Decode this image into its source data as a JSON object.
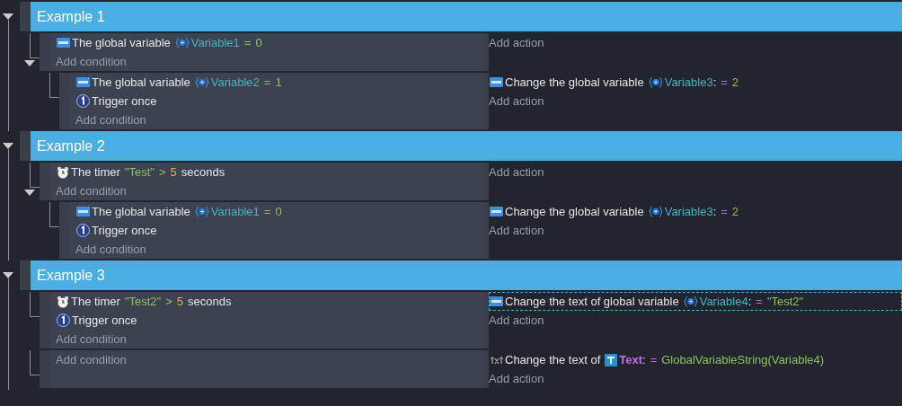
{
  "groups": [
    {
      "title": "Example 1",
      "expanded": true,
      "events": [
        {
          "expanded": true,
          "conditions": [
            {
              "kind": "variable",
              "selected": false,
              "parts": [
                {
                  "kind": "plain",
                  "text": "The global variable"
                },
                {
                  "kind": "variable",
                  "text": "Variable1"
                },
                {
                  "kind": "operator",
                  "text": "="
                },
                {
                  "kind": "number",
                  "text": "0"
                }
              ]
            }
          ],
          "add_condition": "Add condition",
          "add_action": "Add action",
          "children": [
            {
              "conditions": [
                {
                  "kind": "variable",
                  "selected": false,
                  "parts": [
                    {
                      "kind": "plain",
                      "text": "The global variable"
                    },
                    {
                      "kind": "variable",
                      "text": "Variable2"
                    },
                    {
                      "kind": "operator",
                      "text": "="
                    },
                    {
                      "kind": "number",
                      "text": "1"
                    }
                  ]
                },
                {
                  "kind": "trigger",
                  "selected": false,
                  "parts": [
                    {
                      "kind": "plain",
                      "text": "Trigger once"
                    }
                  ]
                }
              ],
              "add_condition": "Add condition",
              "actions": [
                {
                  "kind": "variable",
                  "selected": false,
                  "parts": [
                    {
                      "kind": "plain",
                      "text": "Change the global variable"
                    },
                    {
                      "kind": "variable",
                      "text": "Variable3"
                    },
                    {
                      "kind": "punct",
                      "text": ":"
                    },
                    {
                      "kind": "assign",
                      "text": "="
                    },
                    {
                      "kind": "number",
                      "text": "2"
                    }
                  ]
                }
              ],
              "add_action": "Add action"
            }
          ]
        }
      ]
    },
    {
      "title": "Example 2",
      "expanded": true,
      "events": [
        {
          "expanded": true,
          "conditions": [
            {
              "kind": "timer",
              "selected": false,
              "parts": [
                {
                  "kind": "plain",
                  "text": "The timer"
                },
                {
                  "kind": "string",
                  "text": "\"Test\""
                },
                {
                  "kind": "operator",
                  "text": ">"
                },
                {
                  "kind": "value",
                  "text": "5"
                },
                {
                  "kind": "plain",
                  "text": "seconds"
                }
              ]
            }
          ],
          "add_condition": "Add condition",
          "add_action": "Add action",
          "children": [
            {
              "conditions": [
                {
                  "kind": "variable",
                  "selected": false,
                  "parts": [
                    {
                      "kind": "plain",
                      "text": "The global variable"
                    },
                    {
                      "kind": "variable",
                      "text": "Variable1"
                    },
                    {
                      "kind": "operator",
                      "text": "="
                    },
                    {
                      "kind": "number",
                      "text": "0"
                    }
                  ]
                },
                {
                  "kind": "trigger",
                  "selected": false,
                  "parts": [
                    {
                      "kind": "plain",
                      "text": "Trigger once"
                    }
                  ]
                }
              ],
              "add_condition": "Add condition",
              "actions": [
                {
                  "kind": "variable",
                  "selected": false,
                  "parts": [
                    {
                      "kind": "plain",
                      "text": "Change the global variable"
                    },
                    {
                      "kind": "variable",
                      "text": "Variable3"
                    },
                    {
                      "kind": "punct",
                      "text": ":"
                    },
                    {
                      "kind": "assign",
                      "text": "="
                    },
                    {
                      "kind": "number",
                      "text": "2"
                    }
                  ]
                }
              ],
              "add_action": "Add action"
            }
          ]
        }
      ]
    },
    {
      "title": "Example 3",
      "expanded": true,
      "events": [
        {
          "conditions": [
            {
              "kind": "timer",
              "selected": false,
              "parts": [
                {
                  "kind": "plain",
                  "text": "The timer"
                },
                {
                  "kind": "string",
                  "text": "\"Test2\""
                },
                {
                  "kind": "operator",
                  "text": ">"
                },
                {
                  "kind": "value",
                  "text": "5"
                },
                {
                  "kind": "plain",
                  "text": "seconds"
                }
              ]
            },
            {
              "kind": "trigger",
              "selected": false,
              "parts": [
                {
                  "kind": "plain",
                  "text": "Trigger once"
                }
              ]
            }
          ],
          "add_condition": "Add condition",
          "actions": [
            {
              "kind": "variable",
              "selected": true,
              "parts": [
                {
                  "kind": "plain",
                  "text": "Change the text of global variable"
                },
                {
                  "kind": "variable",
                  "text": "Variable4"
                },
                {
                  "kind": "punct",
                  "text": ":"
                },
                {
                  "kind": "assign",
                  "text": "="
                },
                {
                  "kind": "string",
                  "text": "\"Test2\""
                }
              ]
            }
          ],
          "add_action": "Add action"
        },
        {
          "add_condition": "Add condition",
          "actions": [
            {
              "kind": "text",
              "selected": false,
              "parts": [
                {
                  "kind": "plain",
                  "text": "Change the text of"
                },
                {
                  "kind": "object",
                  "text": "Text"
                },
                {
                  "kind": "punct",
                  "text": ":"
                },
                {
                  "kind": "assign",
                  "text": "="
                },
                {
                  "kind": "string",
                  "text": "GlobalVariableString(Variable4)"
                }
              ]
            }
          ],
          "add_action": "Add action"
        }
      ]
    }
  ]
}
